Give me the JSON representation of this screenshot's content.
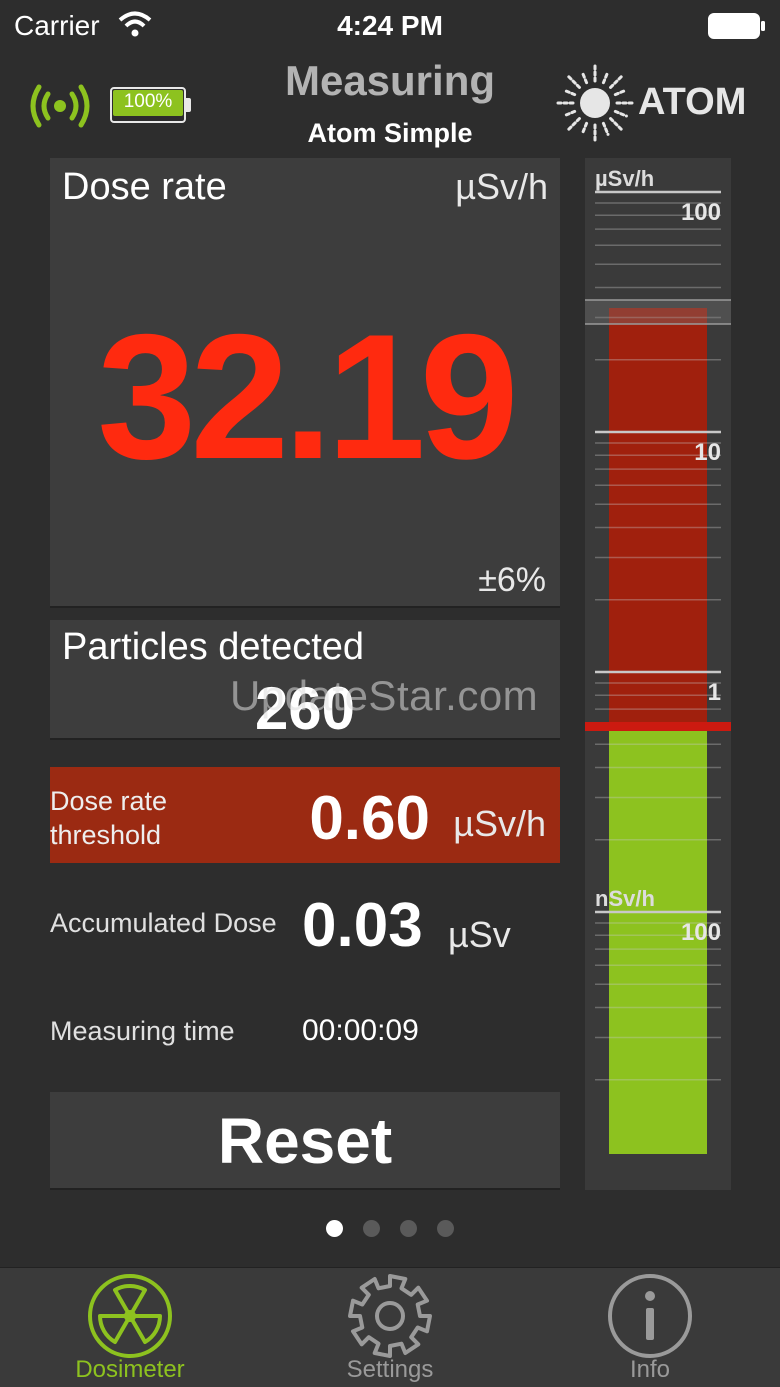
{
  "status_bar": {
    "carrier": "Carrier",
    "time": "4:24 PM"
  },
  "header": {
    "title": "Measuring",
    "subtitle": "Atom Simple",
    "brand": "ATOM",
    "device_battery": {
      "label": "100%",
      "level": 1.0
    }
  },
  "dose_rate": {
    "label": "Dose rate",
    "unit": "µSv/h",
    "value": "32.19",
    "error": "±6%",
    "color": "#ff2a0f"
  },
  "particles": {
    "label": "Particles detected",
    "value": "260"
  },
  "watermark": "UpdateStar.com",
  "threshold": {
    "label": "Dose rate threshold",
    "value": "0.60",
    "unit": "µSv/h",
    "color": "#9b2a12"
  },
  "accumulated": {
    "label": "Accumulated Dose",
    "value": "0.03",
    "unit": "µSv"
  },
  "measuring_time": {
    "label": "Measuring time",
    "value": "00:00:09"
  },
  "reset_label": "Reset",
  "scale": {
    "upper_unit": "µSv/h",
    "lower_unit": "nSv/h",
    "ticks": [
      "100",
      "10",
      "1",
      "100"
    ],
    "high_color": "#a0200d",
    "low_color": "#8dc21f"
  },
  "pager": {
    "pages": 4,
    "current": 1
  },
  "tabs": [
    {
      "label": "Dosimeter",
      "icon": "radiation-icon",
      "active": true
    },
    {
      "label": "Settings",
      "icon": "gear-icon",
      "active": false
    },
    {
      "label": "Info",
      "icon": "info-icon",
      "active": false
    }
  ]
}
